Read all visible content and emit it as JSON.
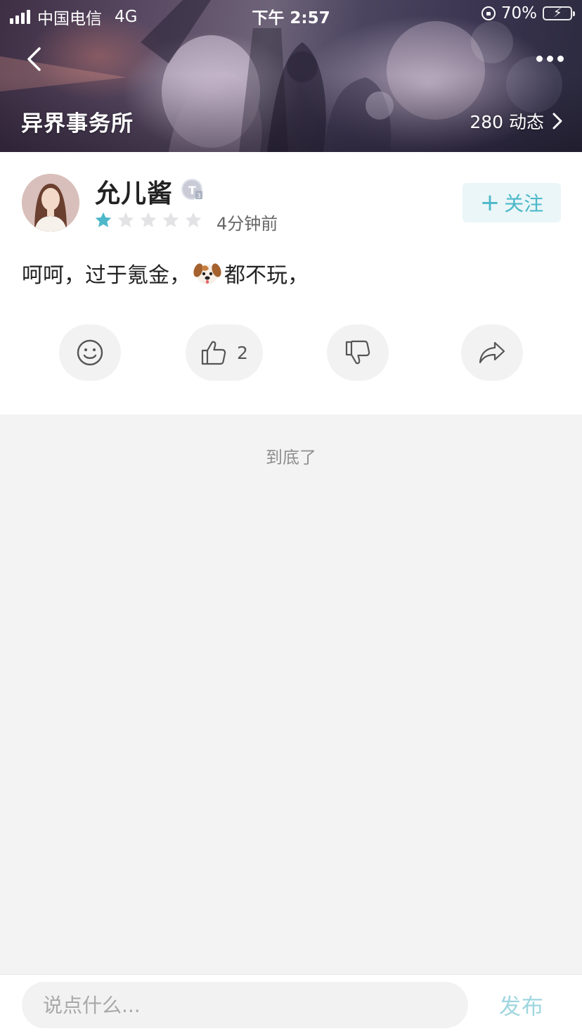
{
  "status_bar": {
    "carrier": "中国电信",
    "network": "4G",
    "time": "下午 2:57",
    "battery": "70%"
  },
  "header": {
    "title": "异界事务所",
    "feed_count": "280 动态"
  },
  "post": {
    "username": "允儿酱",
    "rating": 1,
    "rating_max": 5,
    "time_ago": "4分钟前",
    "follow_label": "关注",
    "content_before_emoji": "呵呵，过于氪金，",
    "content_after_emoji": "都不玩，",
    "like_count": "2"
  },
  "feed_end": "到底了",
  "comment_bar": {
    "placeholder": "说点什么...",
    "publish_label": "发布"
  },
  "colors": {
    "accent": "#4cb8c9",
    "follow_bg": "#eaf6f8",
    "publish_disabled": "#9fd6df"
  }
}
